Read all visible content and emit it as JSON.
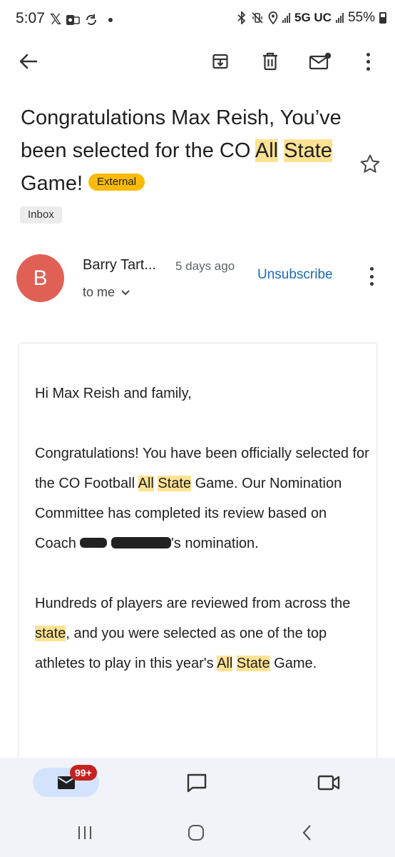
{
  "status_bar": {
    "time": "5:07",
    "network": "5G UC",
    "battery": "55%"
  },
  "toolbar": {
    "back_icon": "arrow-back-icon",
    "archive_icon": "archive-icon",
    "delete_icon": "trash-icon",
    "unread_icon": "mark-unread-icon",
    "more_icon": "more-vert-icon"
  },
  "email": {
    "subject_parts": [
      "Congratulations Max Reish, You’ve been selected for the CO ",
      "All",
      " ",
      "State",
      " Game!"
    ],
    "external_label": "External",
    "label_chip": "Inbox",
    "sender_initial": "B",
    "sender_name": "Barry Tart...",
    "time_ago": "5 days ago",
    "recipient": "to me",
    "unsubscribe": "Unsubscribe",
    "avatar_color": "#e06055",
    "highlight_color": "#fde293"
  },
  "body": {
    "greeting": "Hi Max Reish and family,",
    "p1_a": "Congratulations! You have been officially selected for the CO Football ",
    "p1_hl1": "All",
    "p1_hl2": "State",
    "p1_b": " Game. Our Nomination Committee has completed its review based on Coach ",
    "p1_c": "'s nomination.",
    "p2_a": "Hundreds of players are reviewed from across the ",
    "p2_hl": "state",
    "p2_b": ", and you were selected as one of the top athletes to play in this year's ",
    "p2_hl2": "All",
    "p2_hl3": "State",
    "p2_c": " Game."
  },
  "bottom_nav": {
    "mail_badge": "99+",
    "mail_icon": "mail-icon",
    "chat_icon": "chat-icon",
    "meet_icon": "video-icon"
  },
  "system_nav": {
    "recents_icon": "recents-icon",
    "home_icon": "home-icon",
    "back_icon": "back-chevron-icon"
  }
}
